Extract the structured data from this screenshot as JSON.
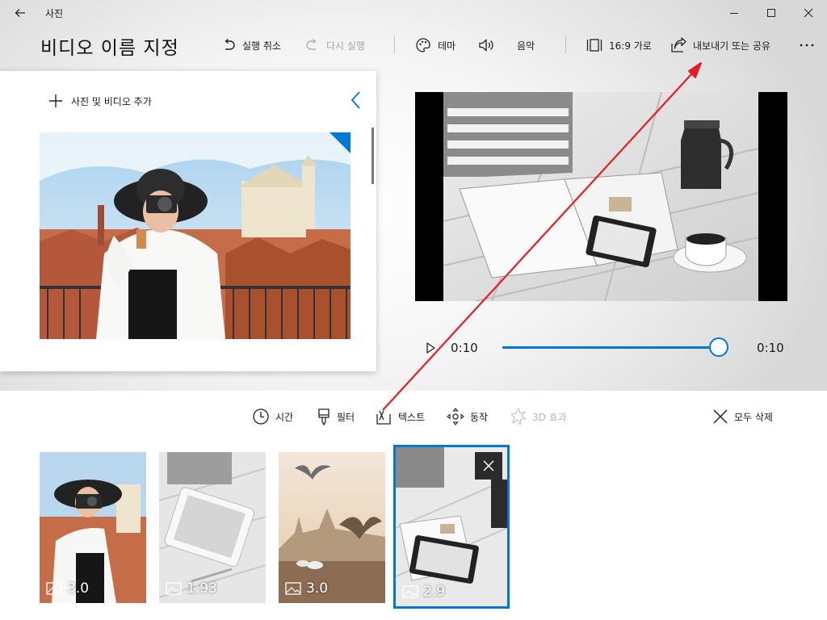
{
  "app": {
    "title": "사진"
  },
  "header": {
    "project_title": "비디오 이름 지정"
  },
  "toolbar": {
    "undo": "실행 취소",
    "redo": "다시 실행",
    "theme": "테마",
    "music": "음악",
    "aspect": "16:9 가로",
    "export": "내보내기 또는 공유"
  },
  "library": {
    "add_label": "사진 및 비디오 추가"
  },
  "player": {
    "current_time": "0:10",
    "total_time": "0:10",
    "progress": 1.0
  },
  "storyboard_tools": {
    "duration": "시간",
    "filter": "필터",
    "text": "텍스트",
    "motion": "동작",
    "effects_3d": "3D 효과",
    "delete_all": "모두 삭제"
  },
  "clips": [
    {
      "duration": "3.0",
      "selected": false
    },
    {
      "duration": "1.93",
      "selected": false
    },
    {
      "duration": "3.0",
      "selected": false
    },
    {
      "duration": "2.9",
      "selected": true
    }
  ],
  "colors": {
    "accent": "#0078d7",
    "annotation_arrow": "#e51c23",
    "slider_fill": "#0078d7"
  },
  "icons": [
    "back-arrow-icon",
    "minimize-icon",
    "maximize-icon",
    "close-icon",
    "undo-icon",
    "redo-icon",
    "palette-icon",
    "speaker-icon",
    "aspect-ratio-icon",
    "share-icon",
    "more-icon",
    "plus-icon",
    "chevron-left-icon",
    "play-icon",
    "clock-icon",
    "brush-icon",
    "text-icon",
    "motion-icon",
    "3d-effects-icon",
    "x-icon",
    "image-icon"
  ]
}
